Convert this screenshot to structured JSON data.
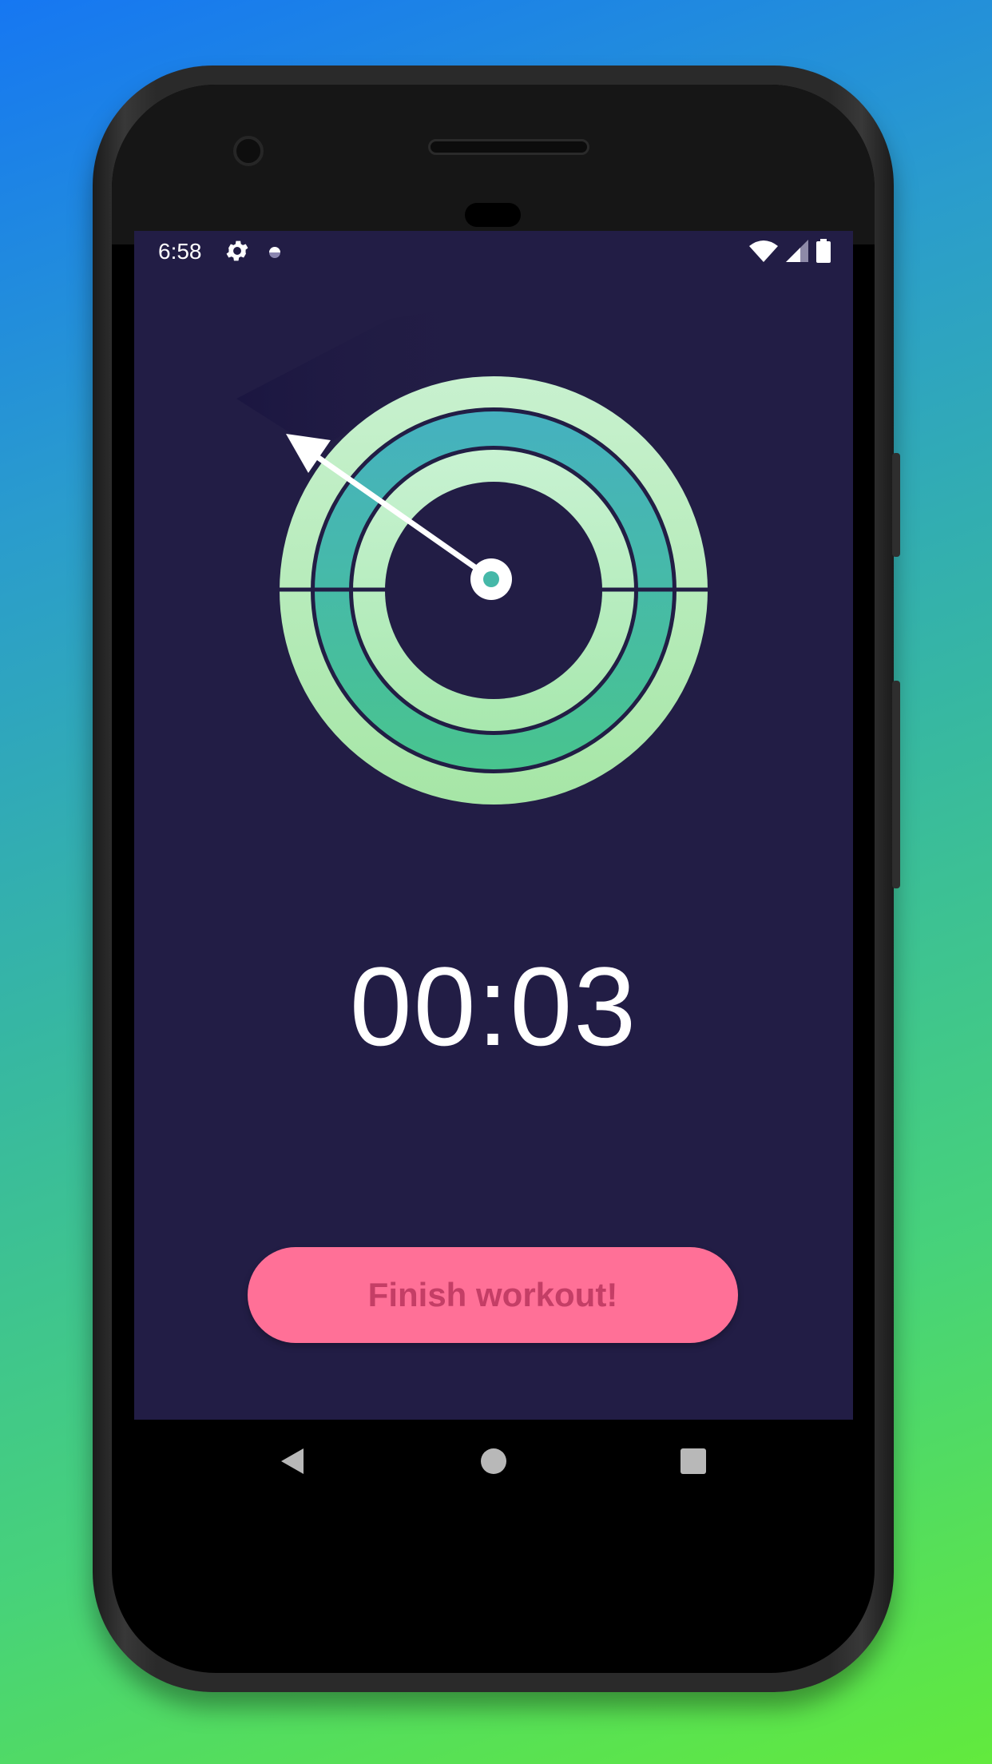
{
  "status_bar": {
    "time": "6:58",
    "left_icons": [
      "gear-icon",
      "circle-indicator-icon"
    ],
    "right_icons": [
      "wifi-icon",
      "signal-icon",
      "battery-icon"
    ]
  },
  "timer": {
    "display": "00:03"
  },
  "finish_button": {
    "label": "Finish workout!"
  },
  "navigation": {
    "icons": [
      "back-icon",
      "home-icon",
      "recents-icon"
    ]
  },
  "colors": {
    "screen_background": "#221d45",
    "ring_outer": "#b8eec2",
    "ring_middle": "#44b8b0",
    "ring_inner": "#bdf0c8",
    "button_background": "#ff7097",
    "button_text": "#c43e66"
  }
}
